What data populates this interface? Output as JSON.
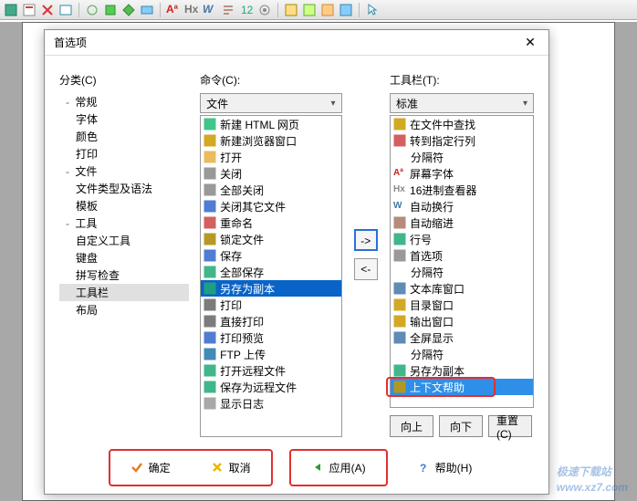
{
  "dialog": {
    "title": "首选项",
    "close": "✕"
  },
  "labels": {
    "category": "分类(C)",
    "command": "命令(C):",
    "toolbar": "工具栏(T):",
    "file_combo": "文件",
    "standard_combo": "标准",
    "moveRight": "->",
    "moveLeft": "<-",
    "up": "向上",
    "down": "向下",
    "reset": "重置(C)",
    "ok": "确定",
    "cancel": "取消",
    "apply": "应用(A)",
    "help": "帮助(H)"
  },
  "tree": [
    {
      "label": "常规",
      "exp": "-",
      "children": [
        {
          "label": "字体"
        },
        {
          "label": "颜色"
        },
        {
          "label": "打印"
        }
      ]
    },
    {
      "label": "文件",
      "exp": "-",
      "children": [
        {
          "label": "文件类型及语法"
        },
        {
          "label": "模板"
        }
      ]
    },
    {
      "label": "工具",
      "exp": "-",
      "children": [
        {
          "label": "自定义工具"
        },
        {
          "label": "键盘"
        },
        {
          "label": "拼写检查"
        },
        {
          "label": "工具栏",
          "selected": true
        },
        {
          "label": "布局"
        }
      ]
    }
  ],
  "commands": [
    {
      "label": "新建 HTML 网页",
      "color": "#2b7"
    },
    {
      "label": "新建浏览器窗口",
      "color": "#c90"
    },
    {
      "label": "打开",
      "color": "#e8b040"
    },
    {
      "label": "关闭",
      "color": "#888"
    },
    {
      "label": "全部关闭",
      "color": "#888"
    },
    {
      "label": "关闭其它文件",
      "color": "#36c"
    },
    {
      "label": "重命名",
      "color": "#c44"
    },
    {
      "label": "锁定文件",
      "color": "#a80"
    },
    {
      "label": "保存",
      "color": "#36c"
    },
    {
      "label": "全部保存",
      "color": "#2a7"
    },
    {
      "label": "另存为副本",
      "color": "#2a7",
      "selected": true
    },
    {
      "label": "打印",
      "color": "#666"
    },
    {
      "label": "直接打印",
      "color": "#666"
    },
    {
      "label": "打印预览",
      "color": "#36c"
    },
    {
      "label": "FTP 上传",
      "color": "#27a"
    },
    {
      "label": "打开远程文件",
      "color": "#2a7"
    },
    {
      "label": "保存为远程文件",
      "color": "#2a7"
    },
    {
      "label": "显示日志",
      "color": "#999"
    }
  ],
  "toolbarItems": [
    {
      "label": "在文件中查找",
      "color": "#c90"
    },
    {
      "label": "转到指定行列",
      "color": "#c44"
    },
    {
      "label": "分隔符",
      "indent": true
    },
    {
      "label": "屏幕字体",
      "color": "#c22",
      "prefix": "Aª"
    },
    {
      "label": "16进制查看器",
      "color": "#888",
      "prefix": "Hx"
    },
    {
      "label": "自动换行",
      "color": "#47a",
      "prefix": "W"
    },
    {
      "label": "自动缩进",
      "color": "#a76"
    },
    {
      "label": "行号",
      "color": "#2a7"
    },
    {
      "label": "首选项",
      "color": "#888"
    },
    {
      "label": "分隔符",
      "indent": true
    },
    {
      "label": "文本库窗口",
      "color": "#47a"
    },
    {
      "label": "目录窗口",
      "color": "#c90"
    },
    {
      "label": "输出窗口",
      "color": "#c90"
    },
    {
      "label": "全屏显示",
      "color": "#47a"
    },
    {
      "label": "分隔符",
      "indent": true
    },
    {
      "label": "另存为副本",
      "color": "#2a7",
      "highlight": true
    },
    {
      "label": "上下文帮助",
      "color": "#c90",
      "selected": true
    }
  ],
  "watermark": {
    "brand": "极速下载站",
    "url": "www.xz7.com"
  }
}
